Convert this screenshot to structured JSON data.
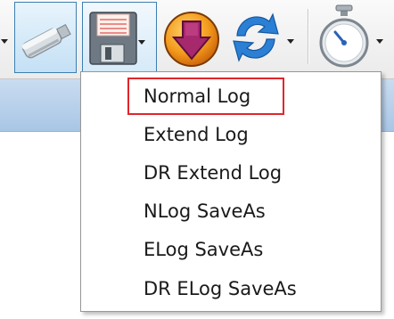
{
  "toolbar": {
    "buttons": [
      {
        "icon": "usb-drive-icon"
      },
      {
        "icon": "floppy-save-icon",
        "has_dropdown": true
      },
      {
        "icon": "download-arrow-icon"
      },
      {
        "icon": "refresh-icon",
        "has_dropdown": true
      },
      {
        "icon": "stopwatch-icon",
        "has_dropdown": true
      }
    ]
  },
  "menu": {
    "items": [
      {
        "label": "Normal Log",
        "highlighted": true
      },
      {
        "label": "Extend Log"
      },
      {
        "label": "DR Extend Log"
      },
      {
        "label": "NLog SaveAs"
      },
      {
        "label": "ELog SaveAs"
      },
      {
        "label": "DR ELog SaveAs"
      }
    ],
    "highlight_color": "#e0262b"
  }
}
